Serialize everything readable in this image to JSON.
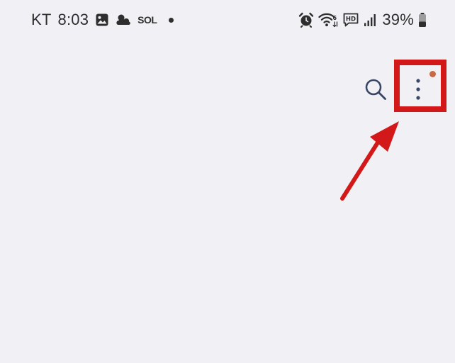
{
  "status_bar": {
    "carrier": "KT",
    "time": "8:03",
    "carrier_logo_text": "SOL",
    "battery": "39%",
    "icons": {
      "gallery": "image-icon",
      "weather": "cloud-icon",
      "alarm": "alarm-icon",
      "wifi": "wifi-6-icon",
      "hd": "hd-voice-icon",
      "signal": "signal-bars-icon",
      "battery": "battery-icon"
    }
  },
  "toolbar": {
    "search_icon": "search-icon",
    "more_icon": "more-vertical-icon",
    "notification_dot": true
  },
  "annotation": {
    "type": "highlight-box-with-arrow",
    "target": "more-options-button"
  },
  "colors": {
    "background": "#f1f1f5",
    "text": "#2e2e2e",
    "icon_blue": "#3a4666",
    "notification_dot": "#c96a45",
    "annotation_red": "#d21818"
  }
}
